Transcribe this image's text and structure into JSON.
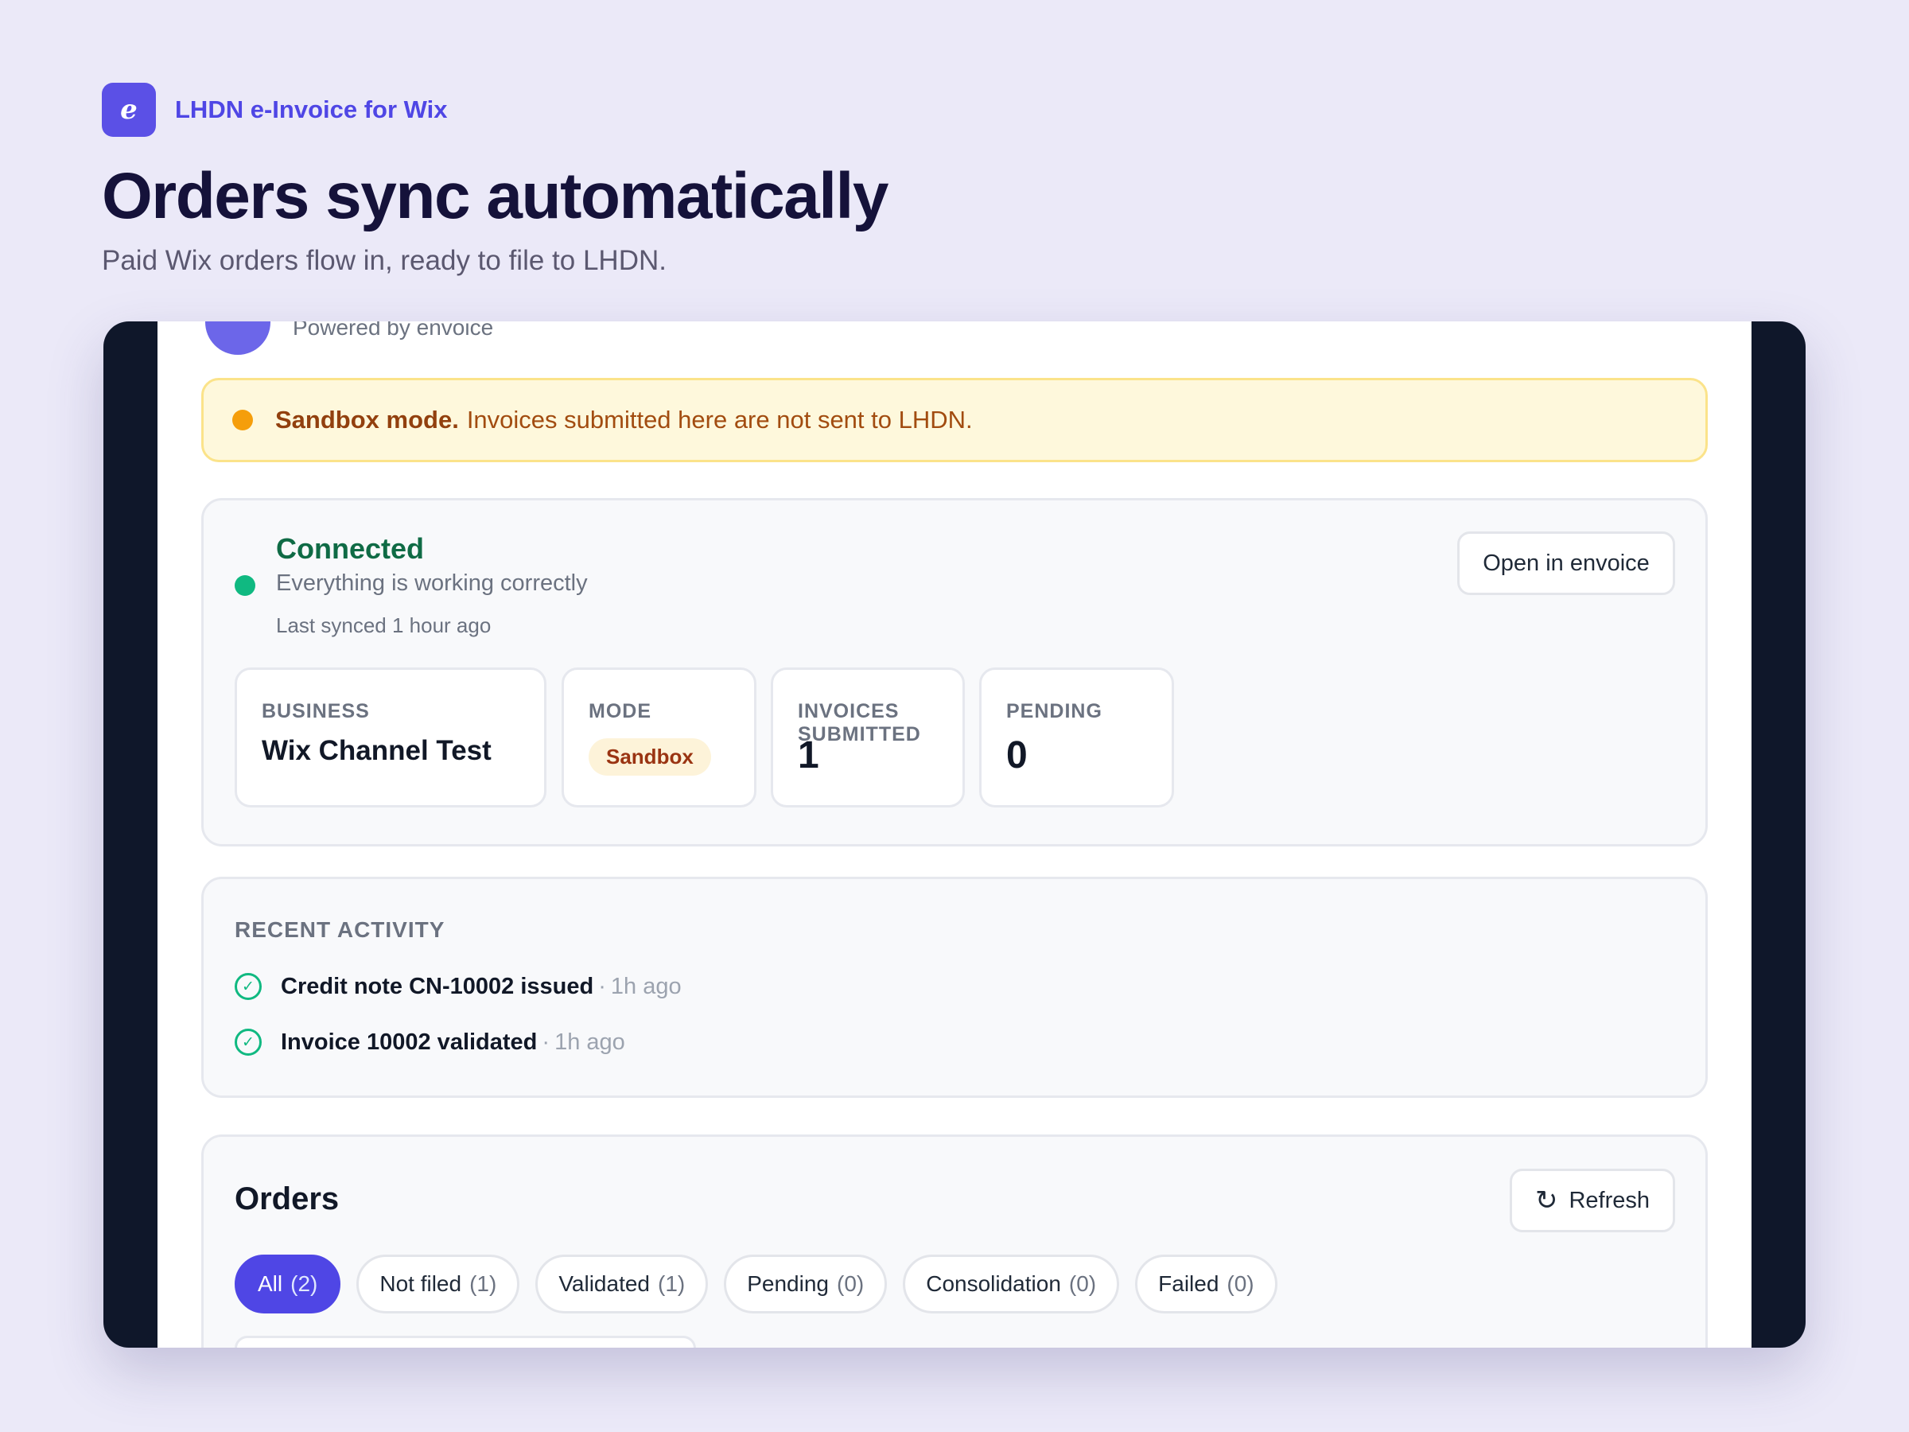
{
  "brand": {
    "logo_letter": "e",
    "name": "LHDN e-Invoice for Wix"
  },
  "hero": {
    "title": "Orders sync automatically",
    "subtitle": "Paid Wix orders flow in, ready to file to LHDN."
  },
  "app": {
    "powered_by": "Powered by envoice",
    "banner": {
      "strong": "Sandbox mode.",
      "text": "Invoices submitted here are not sent to LHDN."
    },
    "status": {
      "title": "Connected",
      "subtitle": "Everything is working correctly",
      "last_synced": "Last synced 1 hour ago",
      "open_button": "Open in envoice"
    },
    "tiles": {
      "business": {
        "label": "BUSINESS",
        "value": "Wix Channel Test"
      },
      "mode": {
        "label": "MODE",
        "value": "Sandbox"
      },
      "invoices": {
        "label": "INVOICES SUBMITTED",
        "value": "1"
      },
      "pending": {
        "label": "PENDING",
        "value": "0"
      }
    },
    "activity": {
      "label": "RECENT ACTIVITY",
      "items": [
        {
          "text": "Credit note CN-10002 issued",
          "sep": "·",
          "time": "1h ago"
        },
        {
          "text": "Invoice 10002 validated",
          "sep": "·",
          "time": "1h ago"
        }
      ]
    },
    "orders": {
      "title": "Orders",
      "refresh_icon": "↻",
      "refresh_label": "Refresh",
      "filters": [
        {
          "label": "All",
          "count": "(2)",
          "active": true
        },
        {
          "label": "Not filed",
          "count": "(1)"
        },
        {
          "label": "Validated",
          "count": "(1)"
        },
        {
          "label": "Pending",
          "count": "(0)"
        },
        {
          "label": "Consolidation",
          "count": "(0)"
        },
        {
          "label": "Failed",
          "count": "(0)"
        }
      ]
    }
  },
  "colors": {
    "accent": "#4f46e5",
    "success": "#10b981",
    "warning": "#f59e0b",
    "device_bezel": "#0f172a",
    "background": "#ebe9f8"
  }
}
